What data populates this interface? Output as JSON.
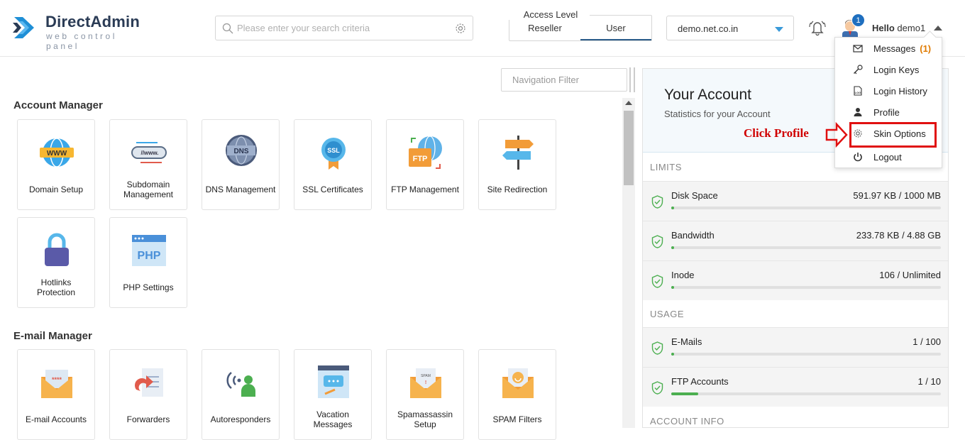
{
  "header": {
    "logo_title": "DirectAdmin",
    "logo_sub": "web control panel",
    "search_placeholder": "Please enter your search criteria",
    "access_level": {
      "label": "Access Level",
      "tabs": [
        "Reseller",
        "User"
      ],
      "active": "User"
    },
    "domain": "demo.net.co.in",
    "notification_count": "1",
    "hello": "Hello",
    "username": "demo1"
  },
  "user_menu": {
    "items": [
      {
        "label": "Messages",
        "count": "(1)",
        "icon": "envelope-icon"
      },
      {
        "label": "Login Keys",
        "icon": "key-icon"
      },
      {
        "label": "Login History",
        "icon": "log-icon"
      },
      {
        "label": "Profile",
        "icon": "user-icon"
      },
      {
        "label": "Skin Options",
        "icon": "gear-icon"
      },
      {
        "label": "Logout",
        "icon": "power-icon"
      }
    ]
  },
  "annotation": {
    "text": "Click Profile"
  },
  "nav_filter_placeholder": "Navigation Filter",
  "sections": [
    {
      "title": "Account Manager",
      "items": [
        {
          "label": "Domain Setup",
          "icon": "www-globe-icon"
        },
        {
          "label": "Subdomain Management",
          "icon": "subdomain-icon"
        },
        {
          "label": "DNS Management",
          "icon": "dns-globe-icon"
        },
        {
          "label": "SSL Certificates",
          "icon": "ssl-badge-icon"
        },
        {
          "label": "FTP Management",
          "icon": "ftp-icon"
        },
        {
          "label": "Site Redirection",
          "icon": "signpost-icon"
        },
        {
          "label": "Hotlinks Protection",
          "icon": "padlock-icon"
        },
        {
          "label": "PHP Settings",
          "icon": "php-icon"
        }
      ]
    },
    {
      "title": "E-mail Manager",
      "items": [
        {
          "label": "E-mail Accounts",
          "icon": "email-password-icon"
        },
        {
          "label": "Forwarders",
          "icon": "forward-document-icon"
        },
        {
          "label": "Autoresponders",
          "icon": "broadcast-user-icon"
        },
        {
          "label": "Vacation Messages",
          "icon": "vacation-message-icon"
        },
        {
          "label": "Spamassassin Setup",
          "icon": "spam-envelope-icon"
        },
        {
          "label": "SPAM Filters",
          "icon": "spam-filter-icon"
        }
      ]
    }
  ],
  "account_panel": {
    "title": "Your Account",
    "subtitle": "Statistics for your Account",
    "limits_label": "LIMITS",
    "limits": [
      {
        "name": "Disk Space",
        "value": "591.97 KB / 1000 MB",
        "fraction": 0.006
      },
      {
        "name": "Bandwidth",
        "value": "233.78 KB / 4.88 GB",
        "fraction": 0.005
      },
      {
        "name": "Inode",
        "value": "106 / Unlimited",
        "fraction": 0.005
      }
    ],
    "usage_label": "USAGE",
    "usage": [
      {
        "name": "E-Mails",
        "value": "1 / 100",
        "fraction": 0.01
      },
      {
        "name": "FTP Accounts",
        "value": "1 / 10",
        "fraction": 0.1
      }
    ],
    "account_info_label": "ACCOUNT INFO"
  },
  "colors": {
    "accent": "#1f6fbf",
    "progress": "#4caf50",
    "annotation": "#d00000"
  }
}
